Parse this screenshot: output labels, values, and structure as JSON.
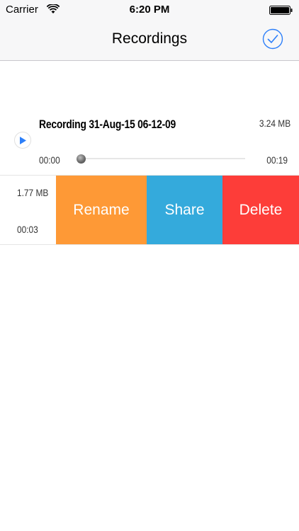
{
  "status_bar": {
    "carrier": "Carrier",
    "time": "6:20 PM",
    "wifi_icon": "wifi-icon",
    "battery_icon": "battery-icon"
  },
  "nav": {
    "title": "Recordings",
    "done_icon": "checkmark-circle-icon"
  },
  "recordings": [
    {
      "title": "Recording 31-Aug-15 06-12-09",
      "size": "3.24 MB",
      "elapsed": "00:00",
      "duration": "00:19",
      "progress": 0.0,
      "play_icon": "play-icon"
    },
    {
      "size": "1.77 MB",
      "duration": "00:03"
    }
  ],
  "swipe_actions": {
    "rename": "Rename",
    "share": "Share",
    "delete": "Delete"
  },
  "colors": {
    "accent": "#2d7ff9",
    "rename": "#fe9936",
    "share": "#34aadc",
    "delete": "#fd3d39"
  }
}
